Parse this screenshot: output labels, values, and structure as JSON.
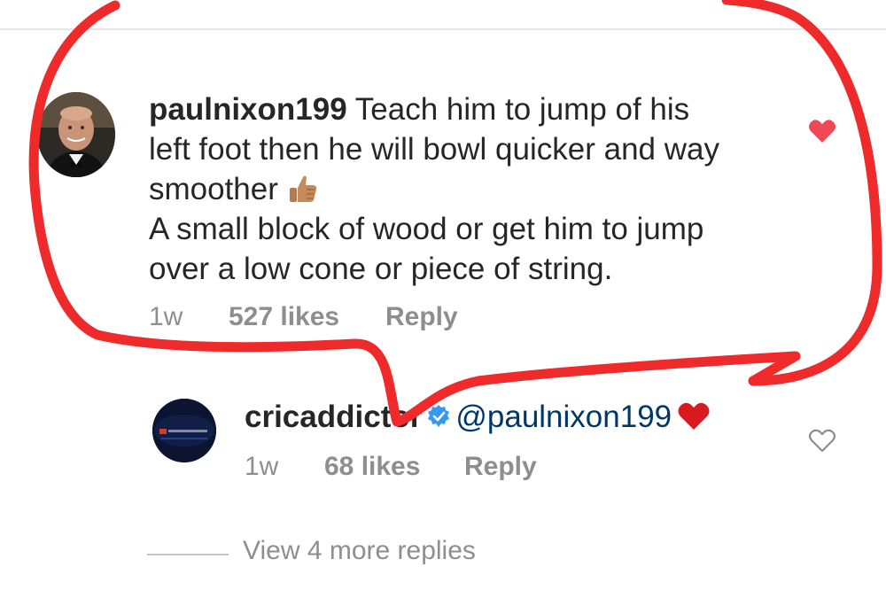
{
  "comment": {
    "username": "paulnixon199",
    "text_line1": "Teach him to jump of his",
    "text_line2": "left foot then he will bowl quicker and way",
    "text_line3": "smoother",
    "text_line4": "A small block of wood or get him to jump",
    "text_line5": "over a low cone or piece of string.",
    "emoji": "thumbs-up",
    "time": "1w",
    "likes": "527 likes",
    "reply_label": "Reply",
    "liked": true,
    "like_color": "#ed4956"
  },
  "reply": {
    "username": "cricaddictor",
    "avatar_text": "Cricket Addictor",
    "verified": true,
    "mention": "@paulnixon199",
    "emoji": "red-heart",
    "time": "1w",
    "likes": "68 likes",
    "reply_label": "Reply",
    "liked": false
  },
  "more_replies": {
    "label": "View 4 more replies"
  },
  "colors": {
    "annotation_stroke": "#ee2a2a",
    "text_primary": "#262626",
    "text_secondary": "#8e8e8e",
    "mention": "#00376b",
    "verified_badge": "#3897f0"
  }
}
